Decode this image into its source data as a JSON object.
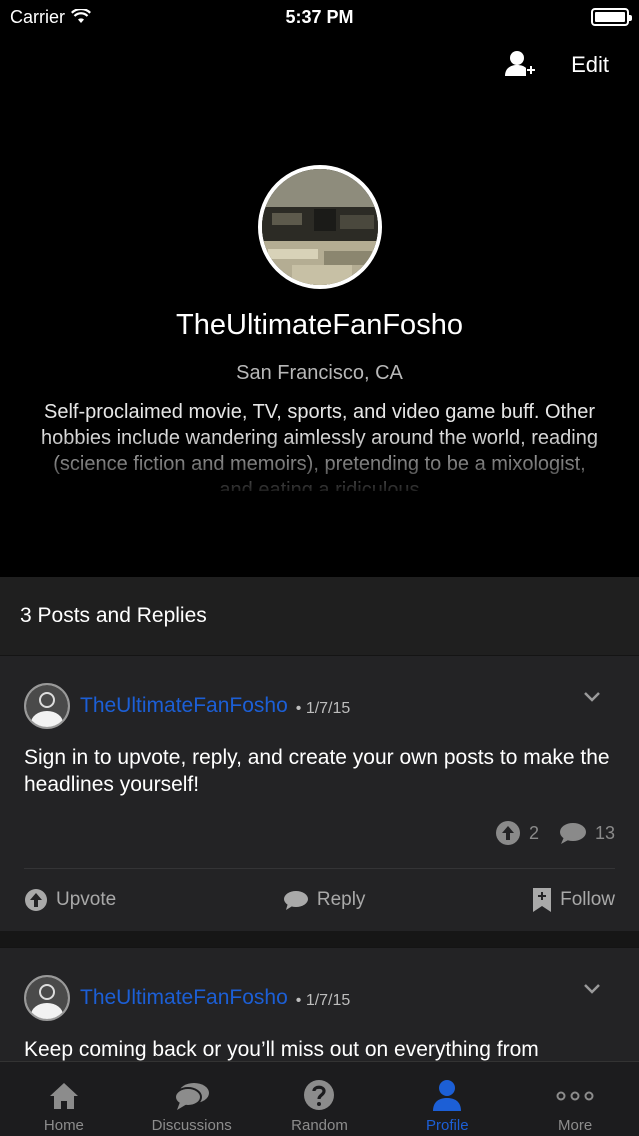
{
  "status": {
    "carrier": "Carrier",
    "time": "5:37 PM"
  },
  "header": {
    "edit_label": "Edit"
  },
  "profile": {
    "username": "TheUltimateFanFosho",
    "location": "San Francisco, CA",
    "bio": "Self-proclaimed movie, TV, sports, and video game buff. Other hobbies include wandering aimlessly around the world, reading (science fiction and memoirs), pretending to be a mixologist, and eating a ridiculous"
  },
  "section": {
    "title": "3 Posts and Replies"
  },
  "posts": [
    {
      "user": "TheUltimateFanFosho",
      "date": "• 1/7/15",
      "text": "Sign in to upvote, reply, and create your own posts to make the headlines yourself!",
      "upvotes": "2",
      "comments": "13",
      "upvote_label": "Upvote",
      "reply_label": "Reply",
      "follow_label": "Follow"
    },
    {
      "user": "TheUltimateFanFosho",
      "date": "• 1/7/15",
      "text": "Keep coming back or you’ll miss out on everything from"
    }
  ],
  "tabs": [
    {
      "label": "Home",
      "icon": "home-icon"
    },
    {
      "label": "Discussions",
      "icon": "chat-bubbles-icon"
    },
    {
      "label": "Random",
      "icon": "question-icon"
    },
    {
      "label": "Profile",
      "icon": "person-icon",
      "active": true
    },
    {
      "label": "More",
      "icon": "more-dots-icon"
    }
  ],
  "colors": {
    "accent": "#1c5fd6",
    "background": "#000000",
    "card": "#232325"
  }
}
